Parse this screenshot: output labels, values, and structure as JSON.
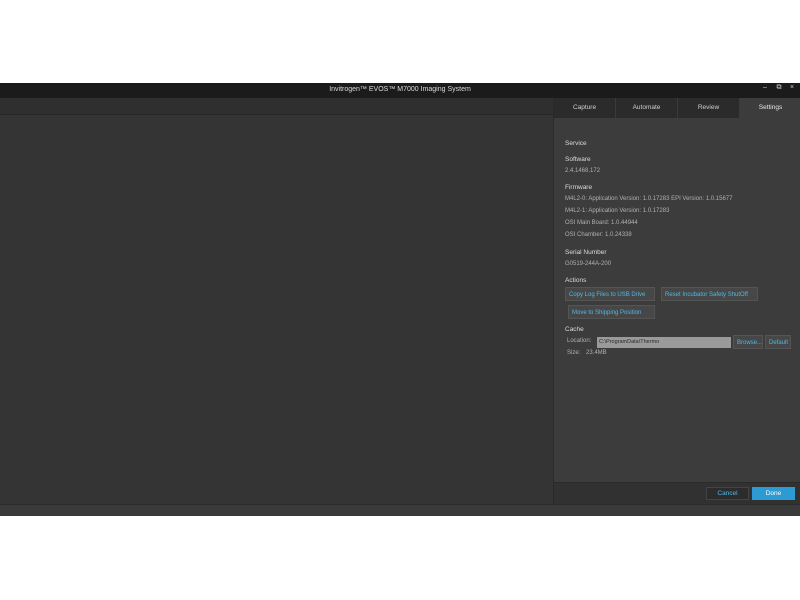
{
  "window": {
    "title": "Invitrogen™ EVOS™ M7000 Imaging System",
    "minimize_glyph": "–",
    "restore_glyph": "⧉",
    "close_glyph": "×"
  },
  "tabs": [
    {
      "label": "Capture"
    },
    {
      "label": "Automate"
    },
    {
      "label": "Review"
    },
    {
      "label": "Settings"
    }
  ],
  "settings": {
    "section_title": "Service",
    "software": {
      "heading": "Software",
      "version": "2.4.1468.172"
    },
    "firmware": {
      "heading": "Firmware",
      "lines": [
        "M4L2-0: Application Version: 1.0.17283  EPI Version: 1.0.15677",
        "M4L2-1: Application Version: 1.0.17283",
        "OSI Main Board: 1.0.44944",
        "OSI Chamber: 1.0.24338"
      ]
    },
    "serial": {
      "heading": "Serial Number",
      "value": "G0519-244A-200"
    },
    "actions": {
      "heading": "Actions",
      "copy_logs": "Copy Log Files to USB Drive",
      "reset_shutoff": "Reset Incubator Safety ShutOff",
      "shipping": "Move to Shipping Position"
    },
    "cache": {
      "heading": "Cache",
      "location_label": "Location:",
      "location_value": "C:\\ProgramData\\Thermo",
      "browse": "Browse...",
      "default": "Default",
      "size_label": "Size:",
      "size_value": "23.4MB"
    }
  },
  "footer": {
    "cancel": "Cancel",
    "done": "Done"
  }
}
